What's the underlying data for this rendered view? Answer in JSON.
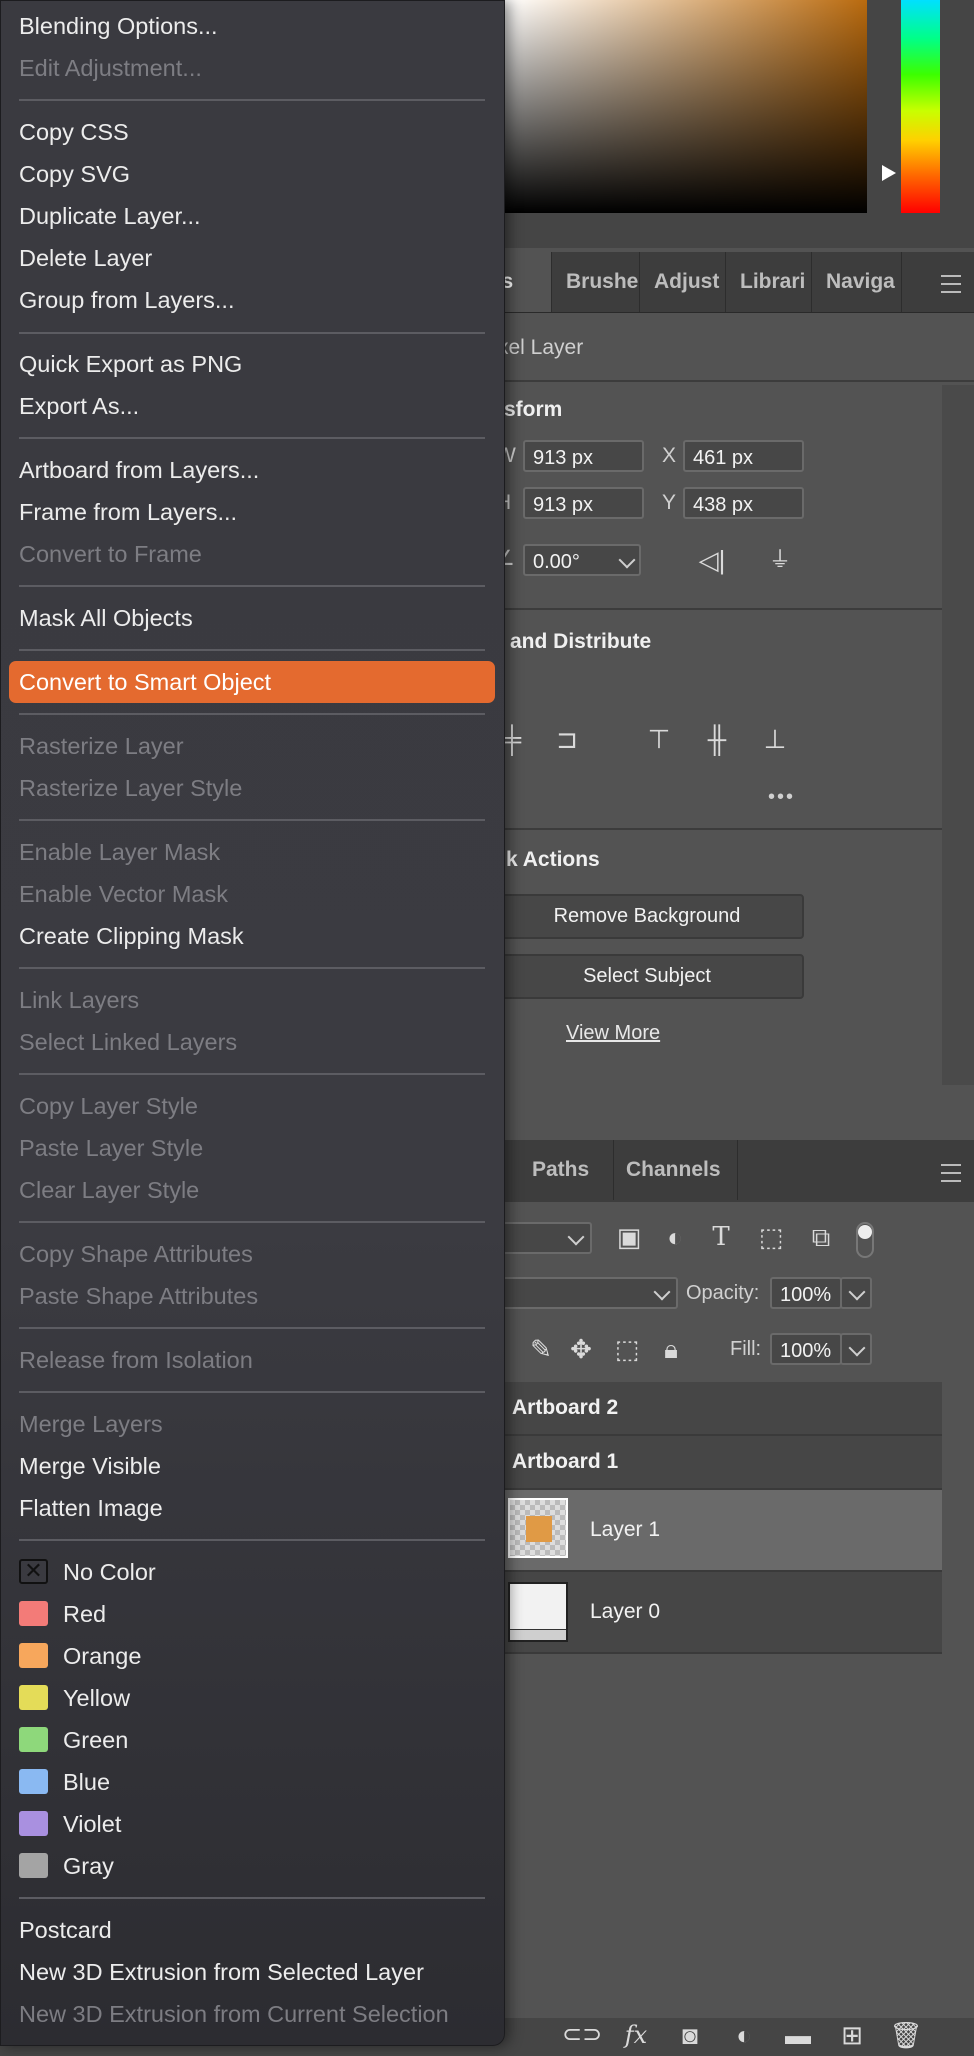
{
  "properties_tabs": [
    "ies",
    "Brushe",
    "Adjust",
    "Librari",
    "Naviga"
  ],
  "layer_kind": "xel Layer",
  "transform": {
    "title": "sform",
    "w_label": "W",
    "w_value": "913 px",
    "x_label": "X",
    "x_value": "461 px",
    "h_label": "H",
    "h_value": "913 px",
    "y_label": "Y",
    "y_value": "438 px",
    "angle_label": "∠",
    "angle_value": "0.00°"
  },
  "align": {
    "title": "and Distribute",
    "more": "•••"
  },
  "quick_actions": {
    "title": "k Actions",
    "remove_bg": "Remove Background",
    "select_subject": "Select Subject",
    "view_more": "View More"
  },
  "layers_tabs": [
    "Paths",
    "Channels"
  ],
  "layers": {
    "opacity_label": "Opacity:",
    "opacity_value": "100%",
    "fill_label": "Fill:",
    "fill_value": "100%",
    "items": [
      {
        "name": "Artboard 2"
      },
      {
        "name": "Artboard 1"
      },
      {
        "name": "Layer 1"
      },
      {
        "name": "Layer 0"
      }
    ]
  },
  "menu": {
    "items": [
      {
        "label": "Blending Options...",
        "enabled": true
      },
      {
        "label": "Edit Adjustment...",
        "enabled": false
      },
      {
        "label": "Copy CSS",
        "enabled": true
      },
      {
        "label": "Copy SVG",
        "enabled": true
      },
      {
        "label": "Duplicate Layer...",
        "enabled": true
      },
      {
        "label": "Delete Layer",
        "enabled": true
      },
      {
        "label": "Group from Layers...",
        "enabled": true
      },
      {
        "label": "Quick Export as PNG",
        "enabled": true
      },
      {
        "label": "Export As...",
        "enabled": true
      },
      {
        "label": "Artboard from Layers...",
        "enabled": true
      },
      {
        "label": "Frame from Layers...",
        "enabled": true
      },
      {
        "label": "Convert to Frame",
        "enabled": false
      },
      {
        "label": "Mask All Objects",
        "enabled": true
      },
      {
        "label": "Convert to Smart Object",
        "enabled": true,
        "highlighted": true
      },
      {
        "label": "Rasterize Layer",
        "enabled": false
      },
      {
        "label": "Rasterize Layer Style",
        "enabled": false
      },
      {
        "label": "Enable Layer Mask",
        "enabled": false
      },
      {
        "label": "Enable Vector Mask",
        "enabled": false
      },
      {
        "label": "Create Clipping Mask",
        "enabled": true
      },
      {
        "label": "Link Layers",
        "enabled": false
      },
      {
        "label": "Select Linked Layers",
        "enabled": false
      },
      {
        "label": "Copy Layer Style",
        "enabled": false
      },
      {
        "label": "Paste Layer Style",
        "enabled": false
      },
      {
        "label": "Clear Layer Style",
        "enabled": false
      },
      {
        "label": "Copy Shape Attributes",
        "enabled": false
      },
      {
        "label": "Paste Shape Attributes",
        "enabled": false
      },
      {
        "label": "Release from Isolation",
        "enabled": false
      },
      {
        "label": "Merge Layers",
        "enabled": false
      },
      {
        "label": "Merge Visible",
        "enabled": true
      },
      {
        "label": "Flatten Image",
        "enabled": true
      },
      {
        "label": "Postcard",
        "enabled": true
      },
      {
        "label": "New 3D Extrusion from Selected Layer",
        "enabled": true
      },
      {
        "label": "New 3D Extrusion from Current Selection",
        "enabled": false
      }
    ],
    "colors": [
      {
        "label": "No Color",
        "color": "none"
      },
      {
        "label": "Red",
        "color": "#f37b78"
      },
      {
        "label": "Orange",
        "color": "#f7a75c"
      },
      {
        "label": "Yellow",
        "color": "#e4dc58"
      },
      {
        "label": "Green",
        "color": "#8ed87b"
      },
      {
        "label": "Blue",
        "color": "#8ab9f2"
      },
      {
        "label": "Violet",
        "color": "#a990e0"
      },
      {
        "label": "Gray",
        "color": "#a4a4a4"
      }
    ]
  }
}
